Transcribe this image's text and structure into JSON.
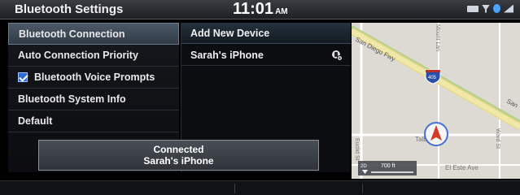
{
  "header": {
    "title": "Bluetooth Settings",
    "time": "11:01",
    "ampm": "AM",
    "status_icons": [
      "battery-icon",
      "antenna-icon",
      "bluetooth-icon",
      "signal-icon"
    ]
  },
  "menu": {
    "items": [
      {
        "label": "Bluetooth Connection",
        "selected": true
      },
      {
        "label": "Auto Connection Priority"
      },
      {
        "label": "Bluetooth Voice Prompts",
        "checked": true
      },
      {
        "label": "Bluetooth System Info"
      },
      {
        "label": "Default"
      }
    ]
  },
  "devices": {
    "add_label": "Add New Device",
    "items": [
      {
        "name": "Sarah's iPhone",
        "icon": "phone-settings-icon"
      }
    ]
  },
  "popup": {
    "line1": "Connected",
    "line2": "Sarah's iPhone"
  },
  "map": {
    "labels": {
      "fwy": "San Diego Fwy",
      "fwy_right": "San",
      "mount": "Mount Lan",
      "shield": "405",
      "talbert": "Talbert",
      "ward": "Ward St",
      "magnolia": "Euclid St",
      "el_este": "El Este Ave",
      "scale": "700 ft",
      "zoom": "2D"
    },
    "colors": {
      "road_major": "#f0e8a8",
      "road_green": "#b7d08a",
      "road_minor": "#ffffff",
      "land": "#dcdad3"
    }
  },
  "colors": {
    "accent": "#2b6cd6",
    "highlight": "#4d5968"
  }
}
